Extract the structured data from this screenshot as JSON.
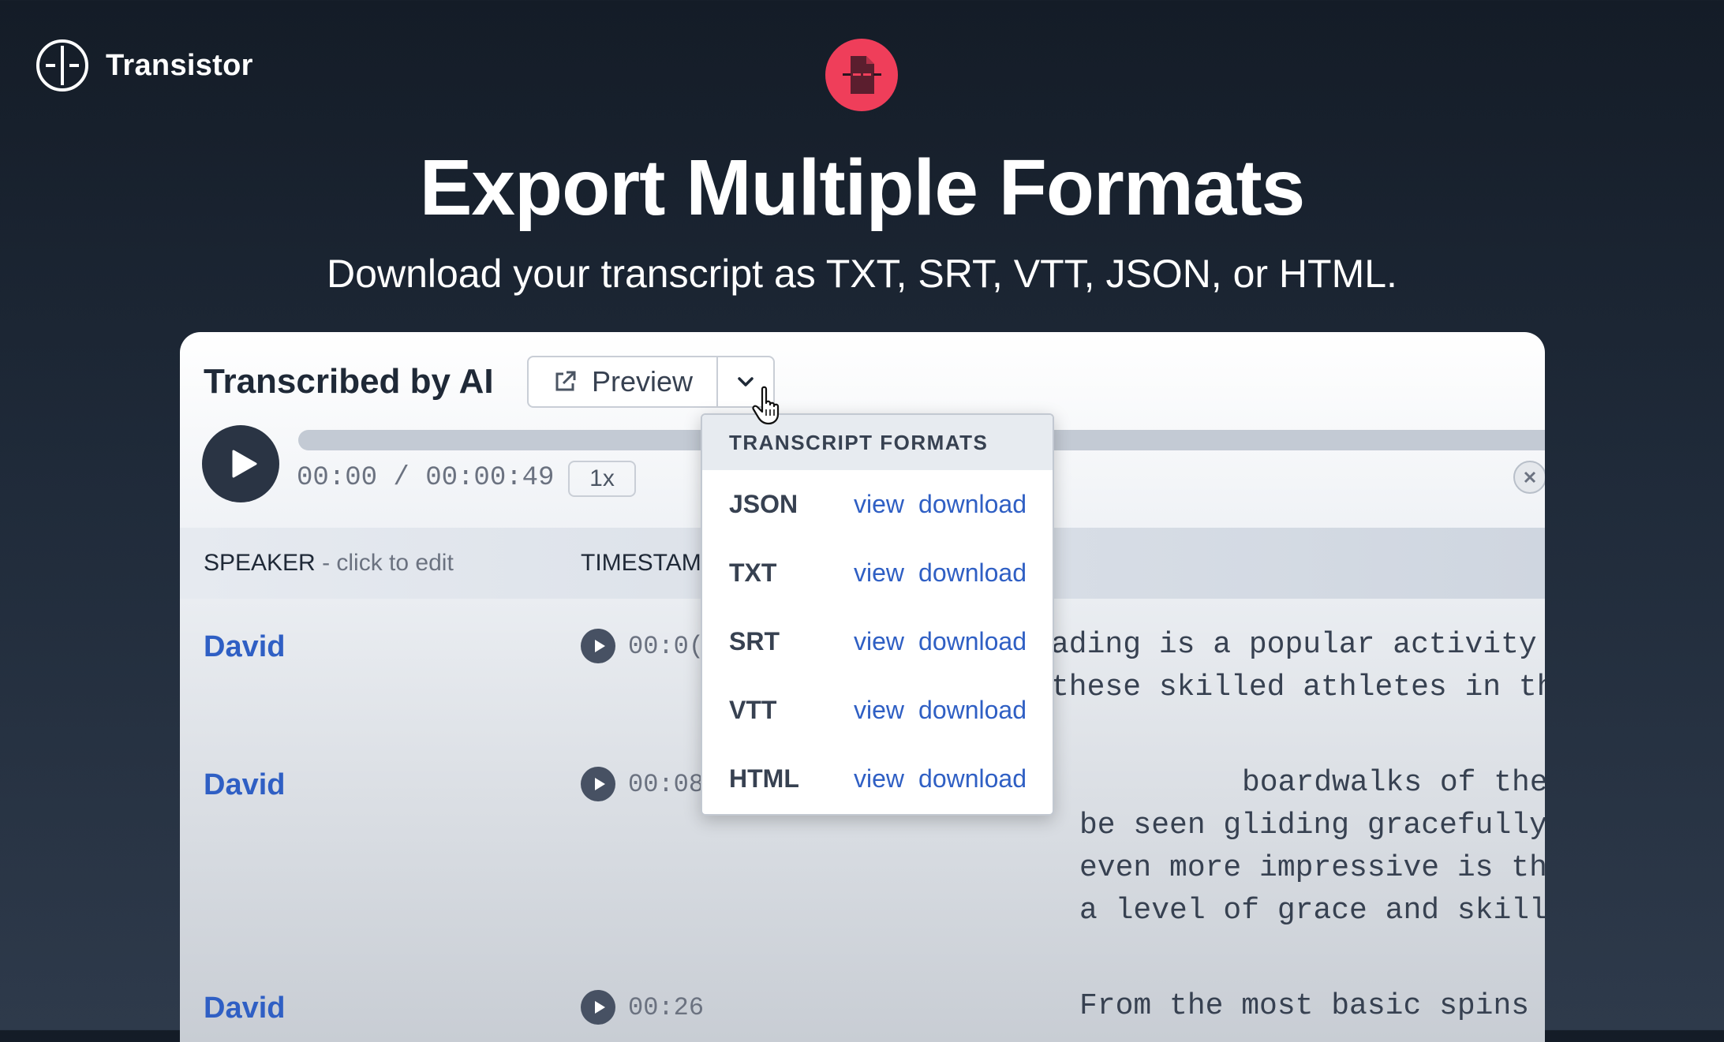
{
  "brand": {
    "name": "Transistor"
  },
  "hero": {
    "title": "Export Multiple Formats",
    "subtitle": "Download your transcript as TXT, SRT, VTT, JSON, or HTML."
  },
  "player": {
    "title": "Transcribed by AI",
    "preview_label": "Preview",
    "time": "00:00 / 00:00:49",
    "speed": "1x"
  },
  "table": {
    "speaker_header": "SPEAKER",
    "speaker_hint": " - click to edit",
    "timestamp_header": "TIMESTAM",
    "rows": [
      {
        "speaker": "David",
        "timestamp": "00:0(",
        "lines": [
          "ading is a popular activity",
          "these skilled athletes in th"
        ]
      },
      {
        "speaker": "David",
        "timestamp": "00:08",
        "lines": [
          "boardwalks of the beach to",
          "be seen gliding gracefully, their mo",
          "even more impressive is the artistry",
          "a level of grace and skill that is t"
        ]
      },
      {
        "speaker": "David",
        "timestamp": "00:26",
        "lines": [
          "From the most basic spins to the mos"
        ]
      }
    ]
  },
  "menu": {
    "header": "TRANSCRIPT FORMATS",
    "items": [
      {
        "format": "JSON",
        "view": "view",
        "download": "download"
      },
      {
        "format": "TXT",
        "view": "view",
        "download": "download"
      },
      {
        "format": "SRT",
        "view": "view",
        "download": "download"
      },
      {
        "format": "VTT",
        "view": "view",
        "download": "download"
      },
      {
        "format": "HTML",
        "view": "view",
        "download": "download"
      }
    ]
  },
  "colors": {
    "accent": "#ef3e5a",
    "link": "#2f5fc4",
    "dark": "#2a3444"
  },
  "icons": {
    "brand": "transistor-logo-icon",
    "hero": "transcript-document-icon",
    "preview": "external-link-icon",
    "dropdown": "chevron-down-icon",
    "cursor": "hand-pointer-icon",
    "play": "play-icon",
    "close": "close-icon"
  }
}
